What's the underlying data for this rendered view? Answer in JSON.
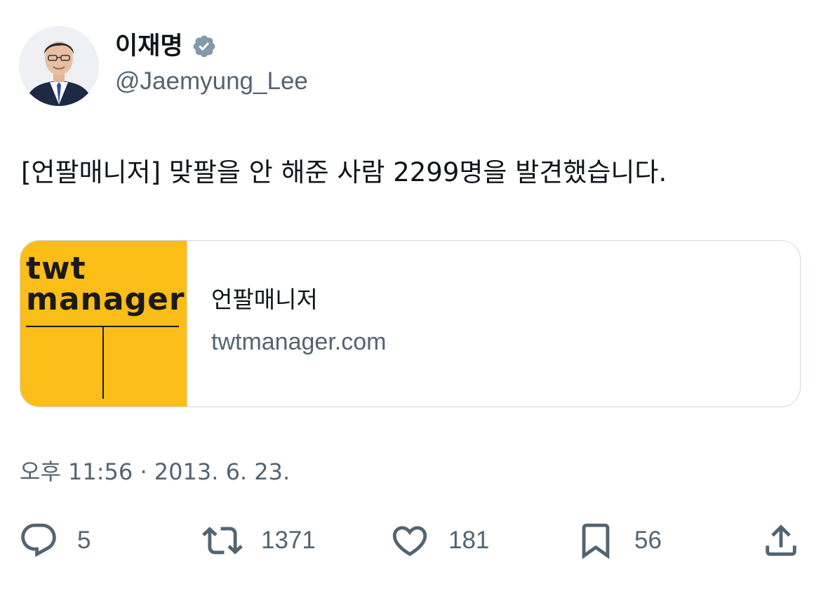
{
  "author": {
    "display_name": "이재명",
    "handle": "@Jaemyung_Lee",
    "verified": true,
    "avatar_icon": "profile-photo"
  },
  "tweet": {
    "text": "[언팔매니저] 맞팔을 안 해준 사람 2299명을 발견했습니다."
  },
  "card": {
    "logo_line1": "twt",
    "logo_line2": "manager",
    "title": "언팔매니저",
    "domain": "twtmanager.com",
    "logo_bg": "#fbbd18"
  },
  "meta": {
    "timestamp": "오후 11:56 · 2013. 6. 23."
  },
  "actions": {
    "reply": {
      "icon": "reply-icon",
      "count": "5"
    },
    "retweet": {
      "icon": "retweet-icon",
      "count": "1371"
    },
    "like": {
      "icon": "heart-icon",
      "count": "181"
    },
    "bookmark": {
      "icon": "bookmark-icon",
      "count": "56"
    },
    "share": {
      "icon": "share-icon"
    }
  },
  "colors": {
    "text": "#0f1419",
    "secondary": "#536471",
    "verified_badge": "#829aab",
    "border": "#cfd9de"
  }
}
